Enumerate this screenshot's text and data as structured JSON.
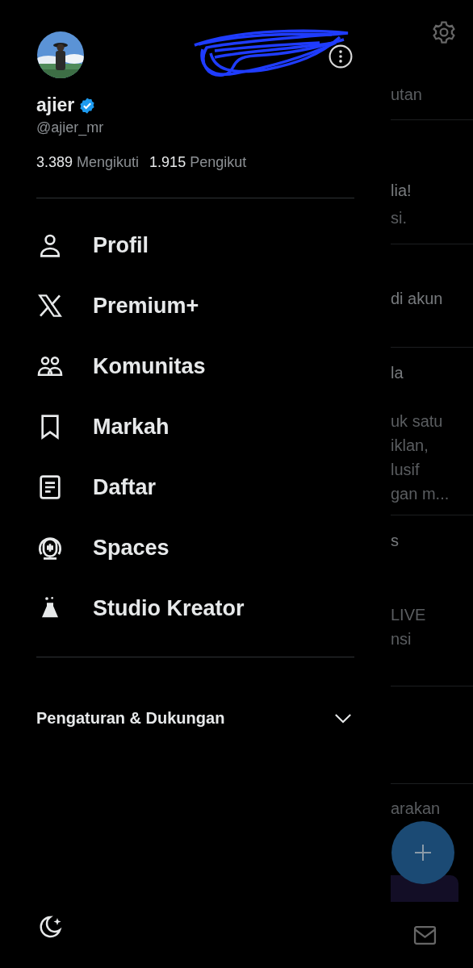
{
  "drawer": {
    "user": {
      "name": "ajier",
      "verified": true,
      "handle": "@ajier_mr",
      "following_count": "3.389",
      "following_label": "Mengikuti",
      "followers_count": "1.915",
      "followers_label": "Pengikut"
    },
    "menu": [
      {
        "label": "Profil",
        "kind": "profile"
      },
      {
        "label": "Premium+",
        "kind": "premium"
      },
      {
        "label": "Komunitas",
        "kind": "communities"
      },
      {
        "label": "Markah",
        "kind": "bookmarks"
      },
      {
        "label": "Daftar",
        "kind": "lists"
      },
      {
        "label": "Spaces",
        "kind": "spaces"
      },
      {
        "label": "Studio Kreator",
        "kind": "studio"
      }
    ],
    "settings": {
      "label": "Pengaturan & Dukungan",
      "expanded": false
    }
  },
  "background": {
    "sections": [
      {
        "lines": [
          {
            "text": "utan",
            "emphasis": false
          }
        ]
      },
      {
        "lines": [
          {
            "text": "lia!",
            "emphasis": true
          },
          {
            "text": "si.",
            "emphasis": false
          }
        ]
      },
      {
        "lines": [
          {
            "text": "di akun",
            "emphasis": true
          }
        ]
      },
      {
        "lines": [
          {
            "text": "la",
            "emphasis": true
          },
          {
            "text": "uk satu",
            "emphasis": false
          },
          {
            "text": "iklan,",
            "emphasis": false
          },
          {
            "text": "lusif",
            "emphasis": false
          },
          {
            "text": "gan m...",
            "emphasis": false
          }
        ]
      },
      {
        "lines": [
          {
            "text": "s",
            "emphasis": true
          },
          {
            "text": "LIVE",
            "emphasis": false
          },
          {
            "text": "nsi",
            "emphasis": false
          }
        ]
      },
      {
        "lines": [
          {
            "text": "arakan",
            "emphasis": false
          }
        ]
      }
    ]
  }
}
